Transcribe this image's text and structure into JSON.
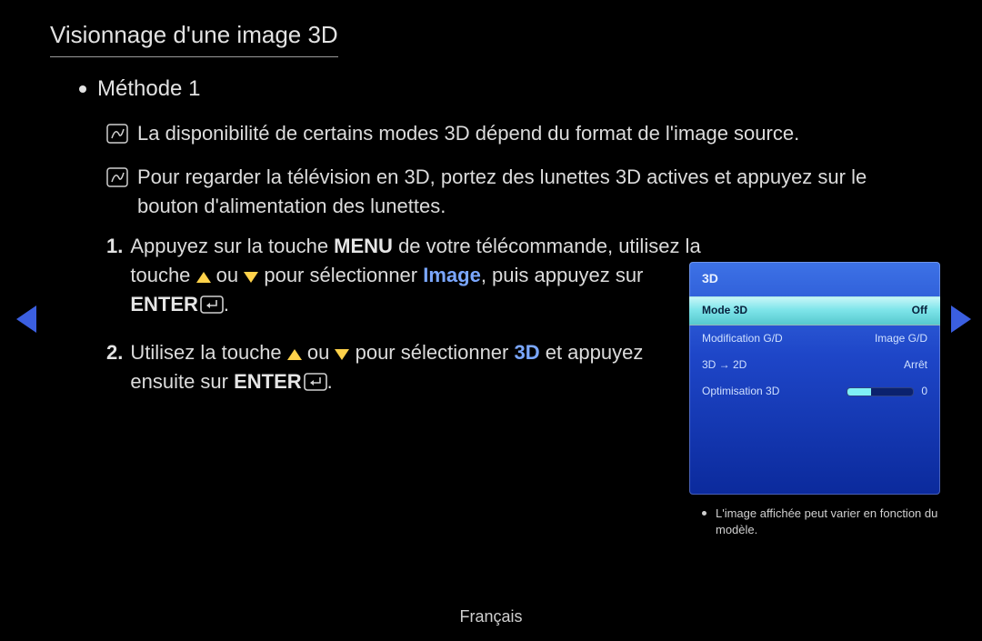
{
  "title": "Visionnage d'une image 3D",
  "method_line": "Méthode 1",
  "notes": [
    "La disponibilité de certains modes 3D dépend du format de l'image source.",
    "Pour regarder la télévision en 3D, portez des lunettes 3D actives et appuyez sur le bouton d'alimentation des lunettes."
  ],
  "steps": {
    "s1": {
      "num": "1.",
      "t1": "Appuyez sur la touche ",
      "menu": "MENU",
      "t2": " de votre télécommande, utilisez la touche ",
      "t3": " ou ",
      "t4": " pour sélectionner ",
      "hl": "Image",
      "t5": ", puis appuyez sur ",
      "enter": "ENTER",
      "dot": "."
    },
    "s2": {
      "num": "2.",
      "t1": "Utilisez la touche ",
      "t2": " ou ",
      "t3": " pour sélectionner ",
      "hl": "3D",
      "t4": " et appuyez ensuite sur ",
      "enter": "ENTER",
      "dot": "."
    }
  },
  "osd": {
    "header": "3D",
    "rows": [
      {
        "label": "Mode 3D",
        "value": "Off",
        "selected": true
      },
      {
        "label": "Modification G/D",
        "value": "Image G/D",
        "selected": false
      },
      {
        "label": "3D → 2D",
        "value": "Arrêt",
        "selected": false
      },
      {
        "label": "Optimisation 3D",
        "value": "0",
        "selected": false,
        "slider": true
      }
    ]
  },
  "caption": "L'image affichée peut varier en fonction du modèle.",
  "footer": "Français"
}
